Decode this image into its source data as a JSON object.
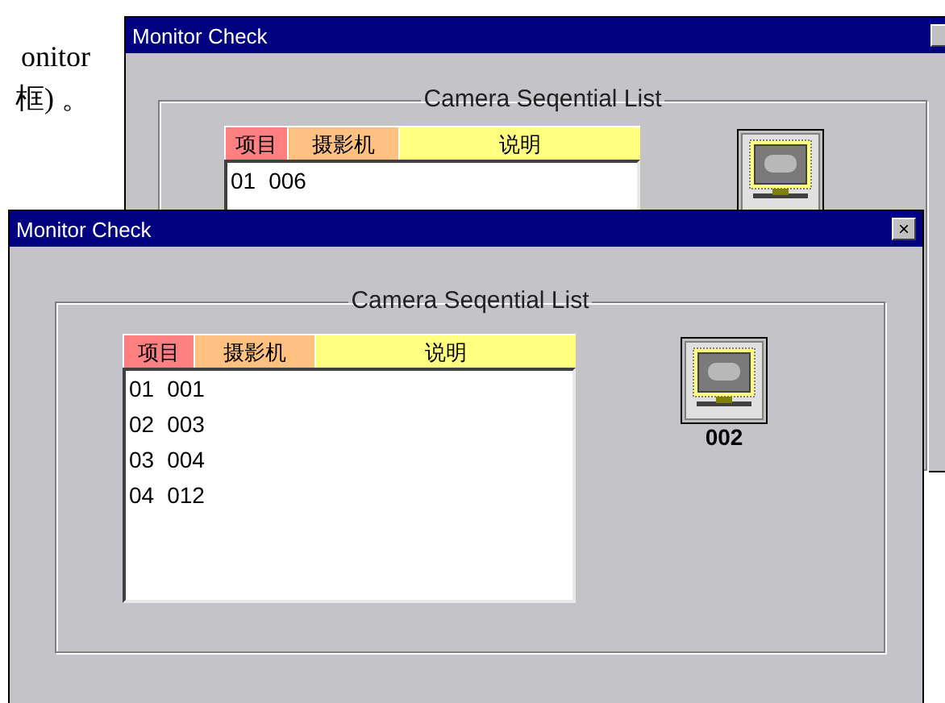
{
  "document_text": [
    "onitor",
    "框) 。"
  ],
  "windows": [
    {
      "title": "Monitor Check",
      "group_title": "Camera Seqential List",
      "columns": [
        {
          "label": "项目",
          "color": "#ff8080"
        },
        {
          "label": "摄影机",
          "color": "#ffc080"
        },
        {
          "label": "说明",
          "color": "#ffff80"
        }
      ],
      "rows": [
        {
          "item": "01",
          "camera": "006"
        }
      ]
    },
    {
      "title": "Monitor Check",
      "close": "×",
      "group_title": "Camera Seqential List",
      "columns": [
        {
          "label": "项目",
          "color": "#ff8080"
        },
        {
          "label": "摄影机",
          "color": "#ffc080"
        },
        {
          "label": "说明",
          "color": "#ffff80"
        }
      ],
      "rows": [
        {
          "item": "01",
          "camera": "001"
        },
        {
          "item": "02",
          "camera": "003"
        },
        {
          "item": "03",
          "camera": "004"
        },
        {
          "item": "04",
          "camera": "012"
        }
      ],
      "monitor_label": "002"
    }
  ]
}
